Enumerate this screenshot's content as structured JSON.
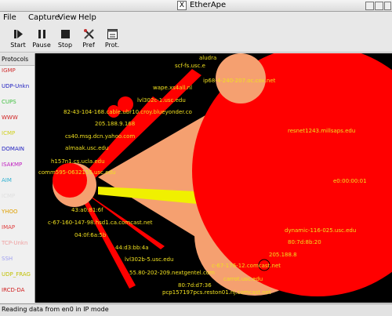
{
  "window": {
    "title": "EtherApe",
    "x_glyph": "X"
  },
  "menu": [
    "File",
    "Capture",
    "View",
    "Help"
  ],
  "toolbar": {
    "start": "Start",
    "pause": "Pause",
    "stop": "Stop",
    "pref": "Pref",
    "prot": "Prot."
  },
  "sidebar": {
    "header": "Protocols",
    "protocols": [
      {
        "name": "IGMP",
        "color": "#d03030"
      },
      {
        "name": "UDP-Unkn",
        "color": "#2020c0"
      },
      {
        "name": "CUPS",
        "color": "#40c040"
      },
      {
        "name": "WWW",
        "color": "#d02020"
      },
      {
        "name": "ICMP",
        "color": "#d0d020"
      },
      {
        "name": "DOMAIN",
        "color": "#2020c0"
      },
      {
        "name": "ISAKMP",
        "color": "#c020c0"
      },
      {
        "name": "AIM",
        "color": "#30b0d0"
      },
      {
        "name": "ICMP",
        "color": "#e0e0e0"
      },
      {
        "name": "YHOO",
        "color": "#e0a000"
      },
      {
        "name": "IMAP",
        "color": "#e04040"
      },
      {
        "name": "TCP-Unkn",
        "color": "#f0a0a0"
      },
      {
        "name": "SSH",
        "color": "#a0a0f0"
      },
      {
        "name": "UDP_FRAG",
        "color": "#c0c000"
      },
      {
        "name": "IRCD-DA",
        "color": "#d02020"
      }
    ]
  },
  "nodes": [
    "aludra",
    "scf-fs.usc.e",
    "ip68-4-240-207.oc.cox.net",
    "wape.xs4all.nl",
    "lvl302c-1.usc.edu",
    "82-43-104-168.cable.ubr10.croy.blueyonder.co",
    "205.188.9.168",
    "cs40.msg.dcn.yahoo.com",
    "almaak.usc.edu",
    "h157n1.cs.ucla.edu",
    "comm595-0632155.usc.edu",
    "43:a0:81:6f",
    "c-67-160-147-98.hsd1.ca.comcast.net",
    "04:0f:6a:5b",
    "44:d3:bb:4a",
    "lvl302b-5.usc.edu",
    "55.80-202-209.nextgentel.com",
    "c-67-176-12.comcast.net",
    "carrot.usc.edu",
    "80:7d:d7:36",
    "pcp157197pcs.reston01.nj.comcast.net",
    "resnet1243.millsaps.edu",
    "e0:00:00:01",
    "dynamic-116-025.usc.edu",
    "80:7d:8b:20",
    "205.188.8"
  ],
  "status": "Reading data from en0 in IP mode",
  "colors": {
    "label": "#f0e020",
    "node_red": "#ff0000",
    "node_peach": "#f5a070",
    "link_yellow": "#f0f000"
  }
}
